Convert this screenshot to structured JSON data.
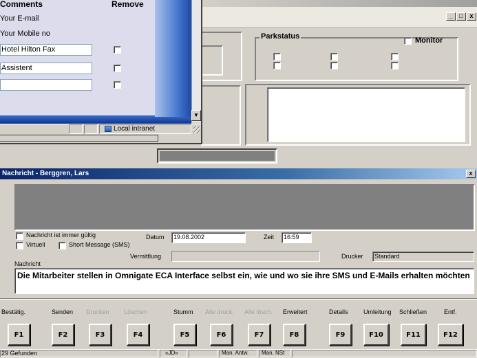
{
  "bg_window": {
    "controls": [
      "_",
      "□",
      "x"
    ],
    "park_label": "Parkstatus",
    "monitor_label": "Monitor"
  },
  "browser_popup": {
    "header_comments": "Comments",
    "header_remove": "Remove",
    "row_email": "Your E-mail",
    "row_mobile": "Your Mobile no",
    "input1": "Hotel Hilton Fax",
    "input2": "Assistent",
    "input3": "",
    "status_zone": "Local intranet"
  },
  "message_window": {
    "title": "Nachricht - Berggren, Lars",
    "close": "x",
    "always_valid": "Nachricht ist immer gültig",
    "virtual": "Virtuell",
    "short_message": "Short Message (SMS)",
    "datum_label": "Datum",
    "datum_value": "19.08.2002",
    "zeit_label": "Zeit",
    "zeit_value": "16:59",
    "vermittlung_label": "Vermittlung",
    "drucker_label": "Drucker",
    "drucker_value": "Standard",
    "nachricht_label": "Nachricht",
    "message_text": "Die Mitarbeiter stellen in Omnigate ECA Interface selbst ein, wie und wo sie ihre SMS und E-Mails erhalten möchten"
  },
  "function_keys": [
    {
      "label": "Bestätig.",
      "key": "F1",
      "enabled": true
    },
    {
      "label": "Senden",
      "key": "F2",
      "enabled": true
    },
    {
      "label": "Drucken",
      "key": "F3",
      "enabled": false
    },
    {
      "label": "Löschen",
      "key": "F4",
      "enabled": false
    },
    {
      "label": "Stumm",
      "key": "F5",
      "enabled": true
    },
    {
      "label": "Alle druck.",
      "key": "F6",
      "enabled": false
    },
    {
      "label": "Alle lösch.",
      "key": "F7",
      "enabled": false
    },
    {
      "label": "Erweitert",
      "key": "F8",
      "enabled": true
    },
    {
      "label": "Details",
      "key": "F9",
      "enabled": true
    },
    {
      "label": "Umleitung",
      "key": "F10",
      "enabled": true
    },
    {
      "label": "Schließen",
      "key": "F11",
      "enabled": true
    },
    {
      "label": "Entf.",
      "key": "F12",
      "enabled": true
    }
  ],
  "statusbar": {
    "found": "29 Gefunden",
    "indicator": "«JD»",
    "man_antw": "Man. Antw.",
    "man_nst": "Man. NSt"
  },
  "colors": {
    "titlebar_start": "#0a246a",
    "titlebar_end": "#a6caf0",
    "panel_gray": "#808080"
  }
}
